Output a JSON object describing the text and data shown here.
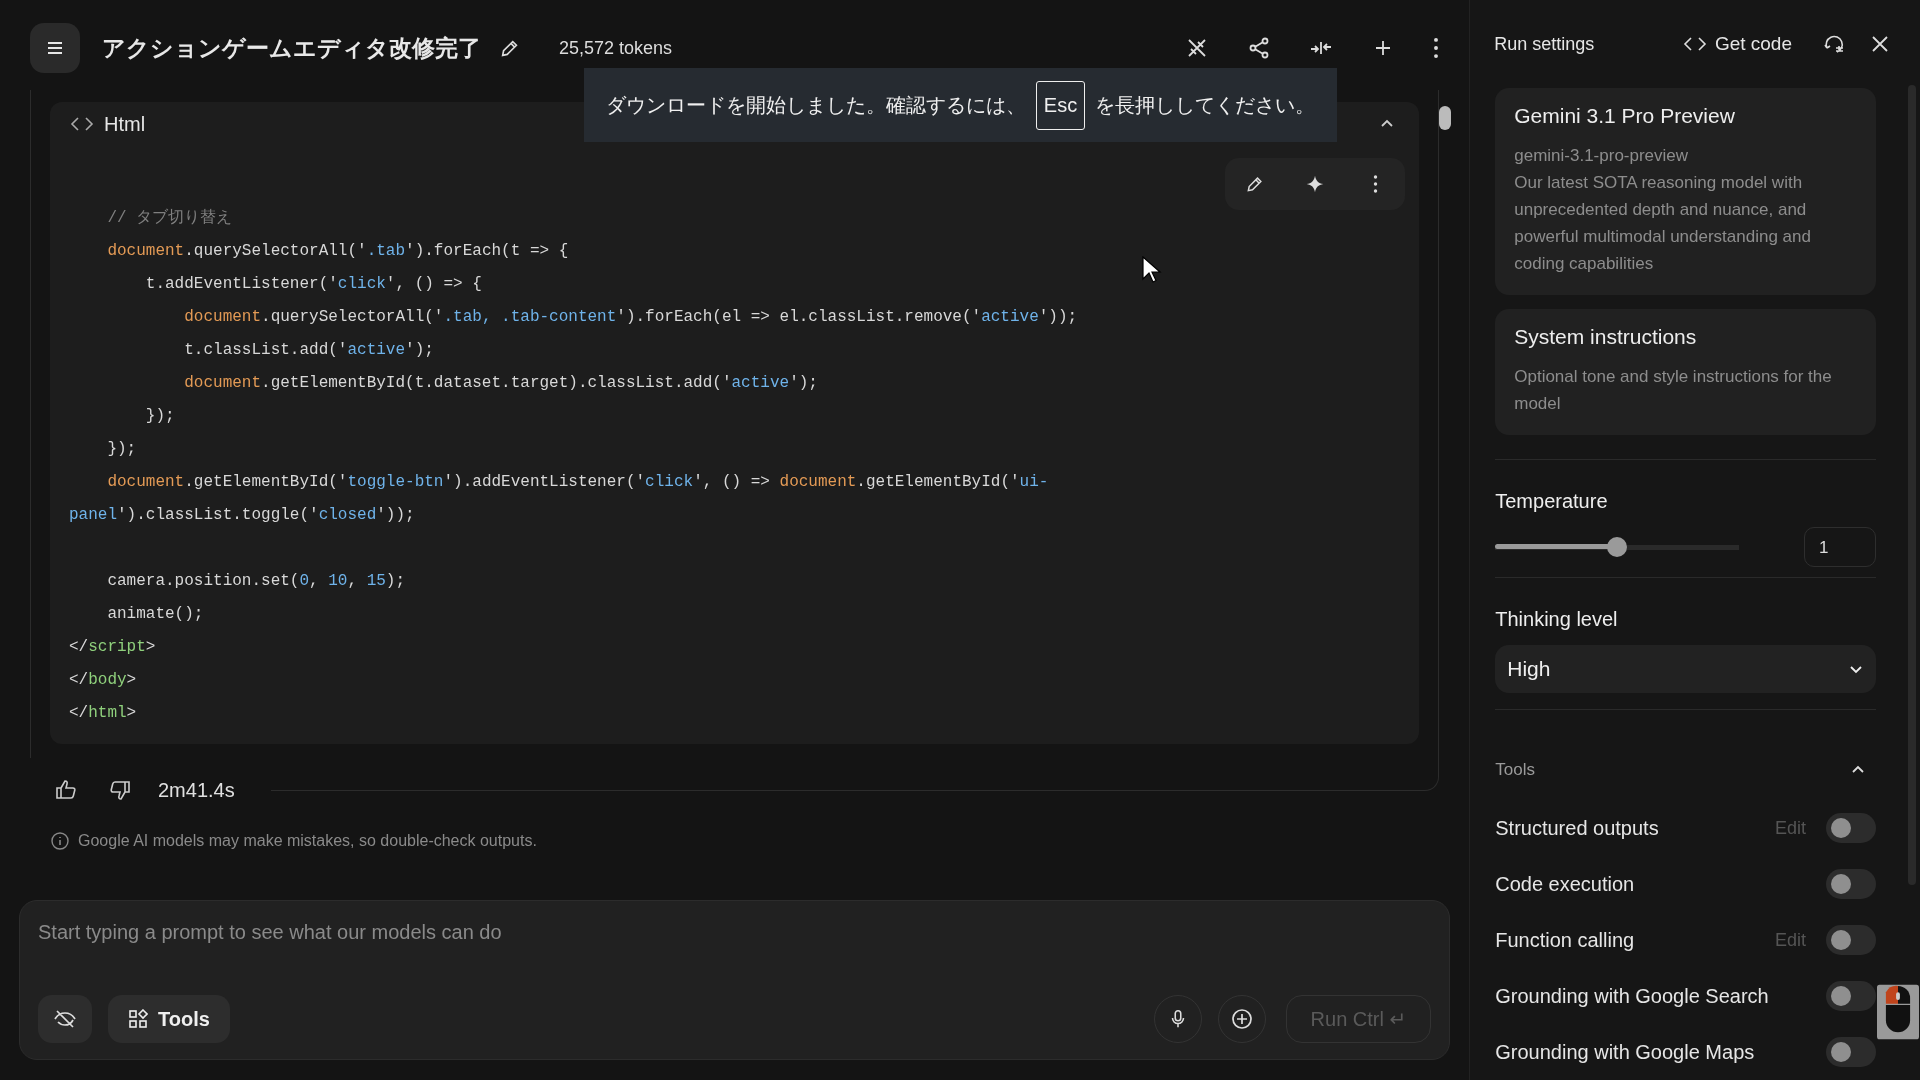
{
  "header": {
    "title": "アクションゲームエディタ改修完了",
    "tokens": "25,572 tokens"
  },
  "toast": {
    "before": "ダウンロードを開始しました。確認するには、",
    "key": "Esc",
    "after": "を長押ししてください。"
  },
  "code_block": {
    "language": "Html",
    "lines": [
      {
        "kind": "code",
        "segments": [
          {
            "kind": "c",
            "text": "    // タブ切り替え"
          }
        ]
      },
      {
        "kind": "code",
        "segments": [
          {
            "kind": "o",
            "text": "    document"
          },
          {
            "kind": "p",
            "text": ".querySelectorAll('"
          },
          {
            "kind": "s",
            "text": ".tab"
          },
          {
            "kind": "p",
            "text": "').forEach(t => {"
          }
        ]
      },
      {
        "kind": "code",
        "segments": [
          {
            "kind": "p",
            "text": "        t.addEventListener('"
          },
          {
            "kind": "s",
            "text": "click"
          },
          {
            "kind": "p",
            "text": "', () => {"
          }
        ]
      },
      {
        "kind": "code",
        "segments": [
          {
            "kind": "o",
            "text": "            document"
          },
          {
            "kind": "p",
            "text": ".querySelectorAll('"
          },
          {
            "kind": "s",
            "text": ".tab, .tab-content"
          },
          {
            "kind": "p",
            "text": "').forEach(el => el.classList.remove('"
          },
          {
            "kind": "s",
            "text": "active"
          },
          {
            "kind": "p",
            "text": "'));"
          }
        ]
      },
      {
        "kind": "code",
        "segments": [
          {
            "kind": "p",
            "text": "            t.classList.add('"
          },
          {
            "kind": "s",
            "text": "active"
          },
          {
            "kind": "p",
            "text": "');"
          }
        ]
      },
      {
        "kind": "code",
        "segments": [
          {
            "kind": "o",
            "text": "            document"
          },
          {
            "kind": "p",
            "text": ".getElementById(t.dataset.target).classList.add('"
          },
          {
            "kind": "s",
            "text": "active"
          },
          {
            "kind": "p",
            "text": "');"
          }
        ]
      },
      {
        "kind": "code",
        "segments": [
          {
            "kind": "p",
            "text": "        });"
          }
        ]
      },
      {
        "kind": "code",
        "segments": [
          {
            "kind": "p",
            "text": "    });"
          }
        ]
      },
      {
        "kind": "code",
        "segments": [
          {
            "kind": "o",
            "text": "    document"
          },
          {
            "kind": "p",
            "text": ".getElementById('"
          },
          {
            "kind": "s",
            "text": "toggle-btn"
          },
          {
            "kind": "p",
            "text": "').addEventListener('"
          },
          {
            "kind": "s",
            "text": "click"
          },
          {
            "kind": "p",
            "text": "', () => "
          },
          {
            "kind": "o",
            "text": "document"
          },
          {
            "kind": "p",
            "text": ".getElementById('"
          },
          {
            "kind": "s",
            "text": "ui-"
          }
        ]
      },
      {
        "kind": "code",
        "segments": [
          {
            "kind": "s",
            "text": "panel"
          },
          {
            "kind": "p",
            "text": "').classList.toggle('"
          },
          {
            "kind": "s",
            "text": "closed"
          },
          {
            "kind": "p",
            "text": "'));"
          }
        ]
      },
      {
        "kind": "blank"
      },
      {
        "kind": "code",
        "segments": [
          {
            "kind": "p",
            "text": "    camera.position.set("
          },
          {
            "kind": "n",
            "text": "0"
          },
          {
            "kind": "p",
            "text": ", "
          },
          {
            "kind": "n",
            "text": "10"
          },
          {
            "kind": "p",
            "text": ", "
          },
          {
            "kind": "n",
            "text": "15"
          },
          {
            "kind": "p",
            "text": ");"
          }
        ]
      },
      {
        "kind": "code",
        "segments": [
          {
            "kind": "p",
            "text": "    animate();"
          }
        ]
      },
      {
        "kind": "code",
        "segments": [
          {
            "kind": "p",
            "text": "</"
          },
          {
            "kind": "g",
            "text": "script"
          },
          {
            "kind": "p",
            "text": ">"
          }
        ]
      },
      {
        "kind": "code",
        "segments": [
          {
            "kind": "p",
            "text": "</"
          },
          {
            "kind": "g",
            "text": "body"
          },
          {
            "kind": "p",
            "text": ">"
          }
        ]
      },
      {
        "kind": "code",
        "segments": [
          {
            "kind": "p",
            "text": "</"
          },
          {
            "kind": "g",
            "text": "html"
          },
          {
            "kind": "p",
            "text": ">"
          }
        ]
      }
    ]
  },
  "response": {
    "duration": "2m41.4s",
    "disclaimer": "Google AI models may make mistakes, so double-check outputs."
  },
  "prompt": {
    "placeholder": "Start typing a prompt to see what our models can do",
    "tools_button": "Tools",
    "run_button": "Run Ctrl ↵"
  },
  "run_settings": {
    "title": "Run settings",
    "get_code": "Get code",
    "model": {
      "name": "Gemini 3.1 Pro Preview",
      "id": "gemini-3.1-pro-preview",
      "description": "Our latest SOTA reasoning model with unprecedented depth and nuance, and powerful multimodal understanding and coding capabilities"
    },
    "system_instructions": {
      "title": "System instructions",
      "placeholder": "Optional tone and style instructions for the model"
    },
    "temperature": {
      "label": "Temperature",
      "level": 0.5,
      "value": "1"
    },
    "thinking_level": {
      "label": "Thinking level",
      "value": "High"
    },
    "tools": {
      "label": "Tools",
      "expanded": true,
      "items": [
        {
          "label": "Structured outputs",
          "edit": "Edit",
          "on": false
        },
        {
          "label": "Code execution",
          "on": false
        },
        {
          "label": "Function calling",
          "edit": "Edit",
          "on": false
        },
        {
          "label": "Grounding with Google Search",
          "on": false
        },
        {
          "label": "Grounding with Google Maps",
          "on": false
        }
      ]
    }
  }
}
